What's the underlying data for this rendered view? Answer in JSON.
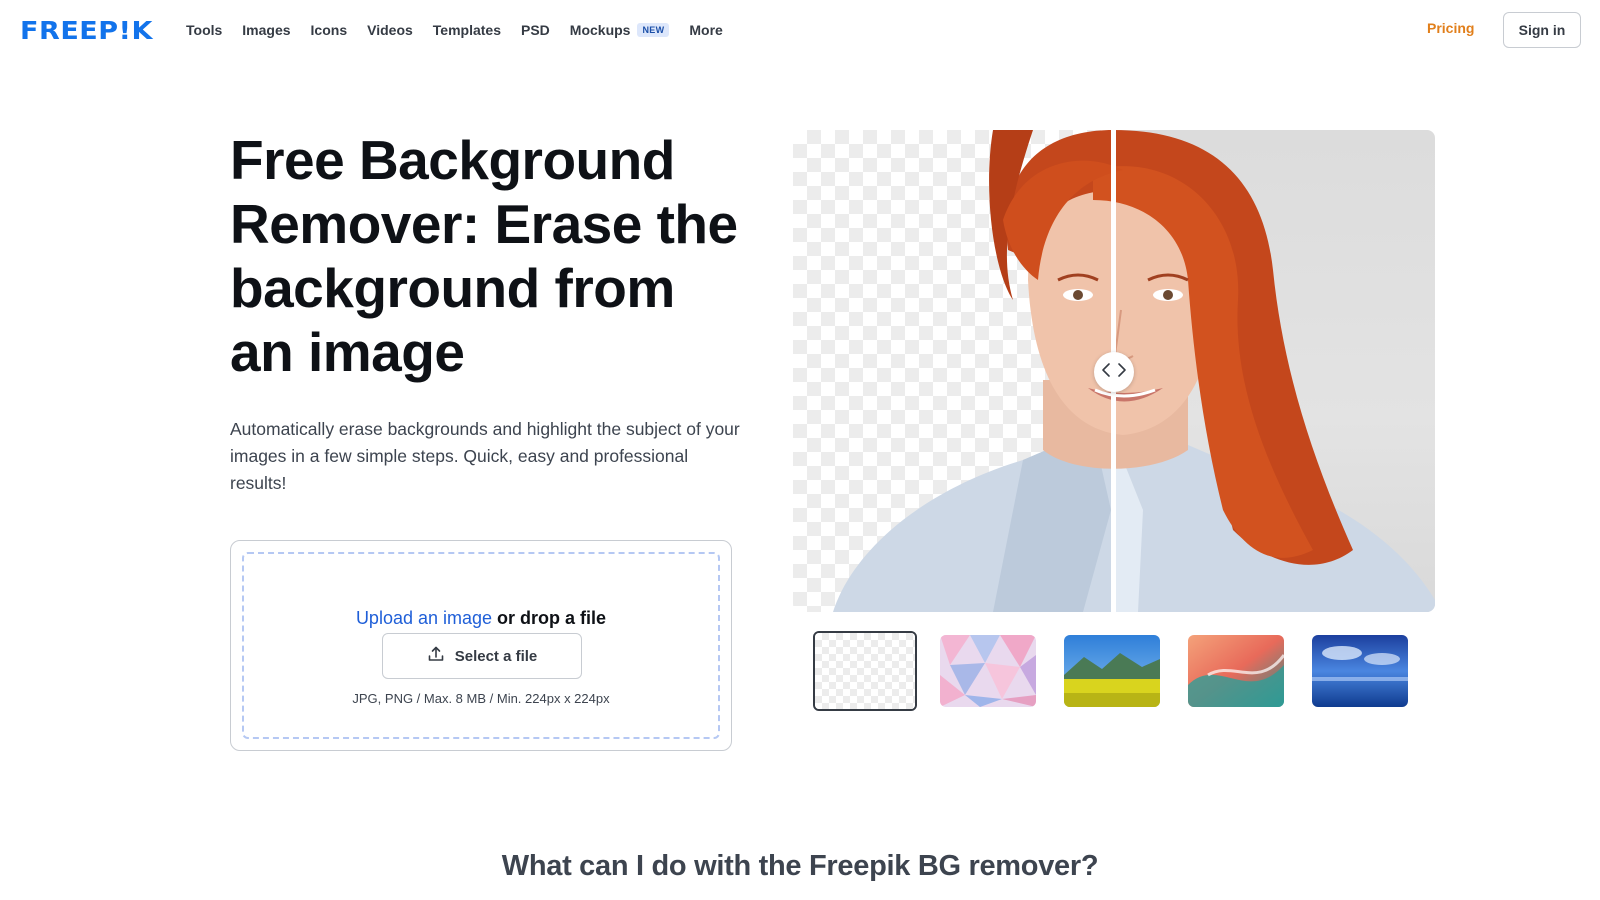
{
  "header": {
    "logo_text": "FREEP!K",
    "nav": [
      {
        "label": "Tools"
      },
      {
        "label": "Images"
      },
      {
        "label": "Icons"
      },
      {
        "label": "Videos"
      },
      {
        "label": "Templates"
      },
      {
        "label": "PSD"
      },
      {
        "label": "Mockups",
        "badge": "NEW"
      },
      {
        "label": "More"
      }
    ],
    "pricing_label": "Pricing",
    "signin_label": "Sign in"
  },
  "hero": {
    "title": "Free Background Remover: Erase the background from an image",
    "subtitle": "Automatically erase backgrounds and highlight the subject of your images in a few simple steps. Quick, easy and professional results!",
    "upload": {
      "link_text": "Upload an image",
      "drop_text": " or drop a file",
      "select_label": "Select a file",
      "note": "JPG, PNG / Max. 8 MB / Min. 224px x 224px"
    }
  },
  "preview": {
    "handle_icon": "chevron-left-right-icon",
    "backgrounds": [
      {
        "name": "transparent",
        "selected": true
      },
      {
        "name": "pastel-triangles",
        "selected": false
      },
      {
        "name": "mountain-meadow",
        "selected": false
      },
      {
        "name": "colorful-wave",
        "selected": false
      },
      {
        "name": "ocean-sky",
        "selected": false
      }
    ]
  },
  "section": {
    "title": "What can I do with the Freepik BG remover?"
  },
  "colors": {
    "brand": "#1273eb",
    "pricing": "#e17f1b",
    "link": "#1f5fd8"
  }
}
